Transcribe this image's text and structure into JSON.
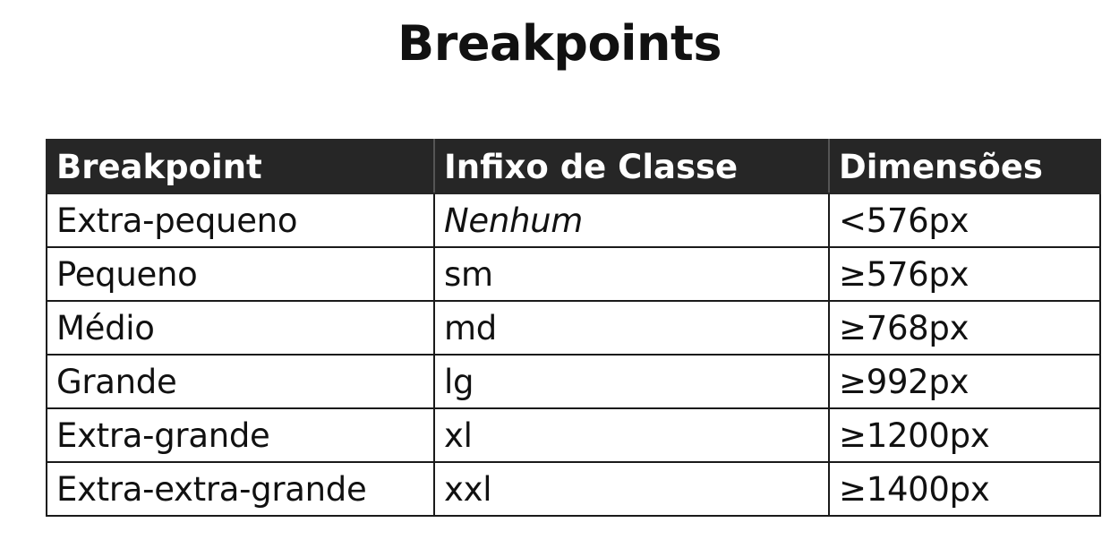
{
  "title": "Breakpoints",
  "table": {
    "headers": [
      "Breakpoint",
      "Infixo de Classe",
      "Dimensões"
    ],
    "rows": [
      {
        "breakpoint": "Extra-pequeno",
        "infix": "Nenhum",
        "dimension": "<576px"
      },
      {
        "breakpoint": "Pequeno",
        "infix": "sm",
        "dimension": "≥576px"
      },
      {
        "breakpoint": "Médio",
        "infix": "md",
        "dimension": "≥768px"
      },
      {
        "breakpoint": "Grande",
        "infix": "lg",
        "dimension": "≥992px"
      },
      {
        "breakpoint": "Extra-grande",
        "infix": "xl",
        "dimension": "≥1200px"
      },
      {
        "breakpoint": "Extra-extra-grande",
        "infix": "xxl",
        "dimension": "≥1400px"
      }
    ]
  },
  "colors": {
    "header_background": "#262626",
    "header_text": "#ffffff",
    "border": "#1a1a1a",
    "body_text": "#111111",
    "page_background": "#ffffff"
  }
}
